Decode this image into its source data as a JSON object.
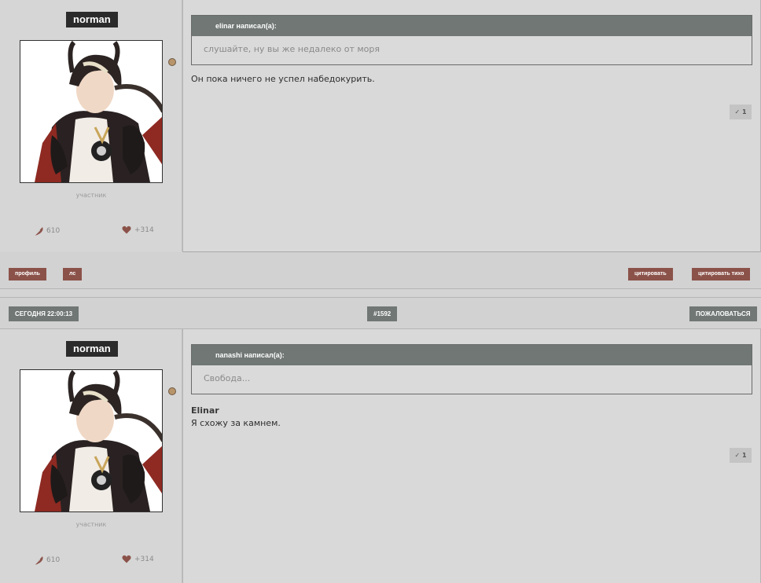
{
  "colors": {
    "header_button": "#707775",
    "action_button": "#8b5249",
    "username_bg": "#2b2b2b",
    "online_dot": "#b8946a"
  },
  "posts": [
    {
      "author": {
        "name": "norman",
        "rank": "участник",
        "posts": "610",
        "reputation": "+314"
      },
      "quote": {
        "header": "elinar написал(а):",
        "text": "слушайте, ну вы же недалеко от моря"
      },
      "body": {
        "line1": "Он пока ничего не успел набедокурить."
      },
      "like": "✓ 1",
      "footer": {
        "profile": "профиль",
        "pm": "лс",
        "quote": "цитировать",
        "quote_silent": "цитировать тихо"
      }
    },
    {
      "header": {
        "date": "СЕГОДНЯ 22:00:13",
        "number": "#1592",
        "report": "ПОЖАЛОВАТЬСЯ"
      },
      "author": {
        "name": "norman",
        "rank": "участник",
        "posts": "610",
        "reputation": "+314"
      },
      "quote": {
        "header": "nanashi написал(а):",
        "text": "Свобода..."
      },
      "body": {
        "name": "Elinar",
        "line1": "Я схожу за камнем."
      },
      "like": "✓ 1"
    }
  ],
  "icons": {
    "posts": "feather-icon",
    "reputation": "heart-icon",
    "status": "online-dot"
  }
}
